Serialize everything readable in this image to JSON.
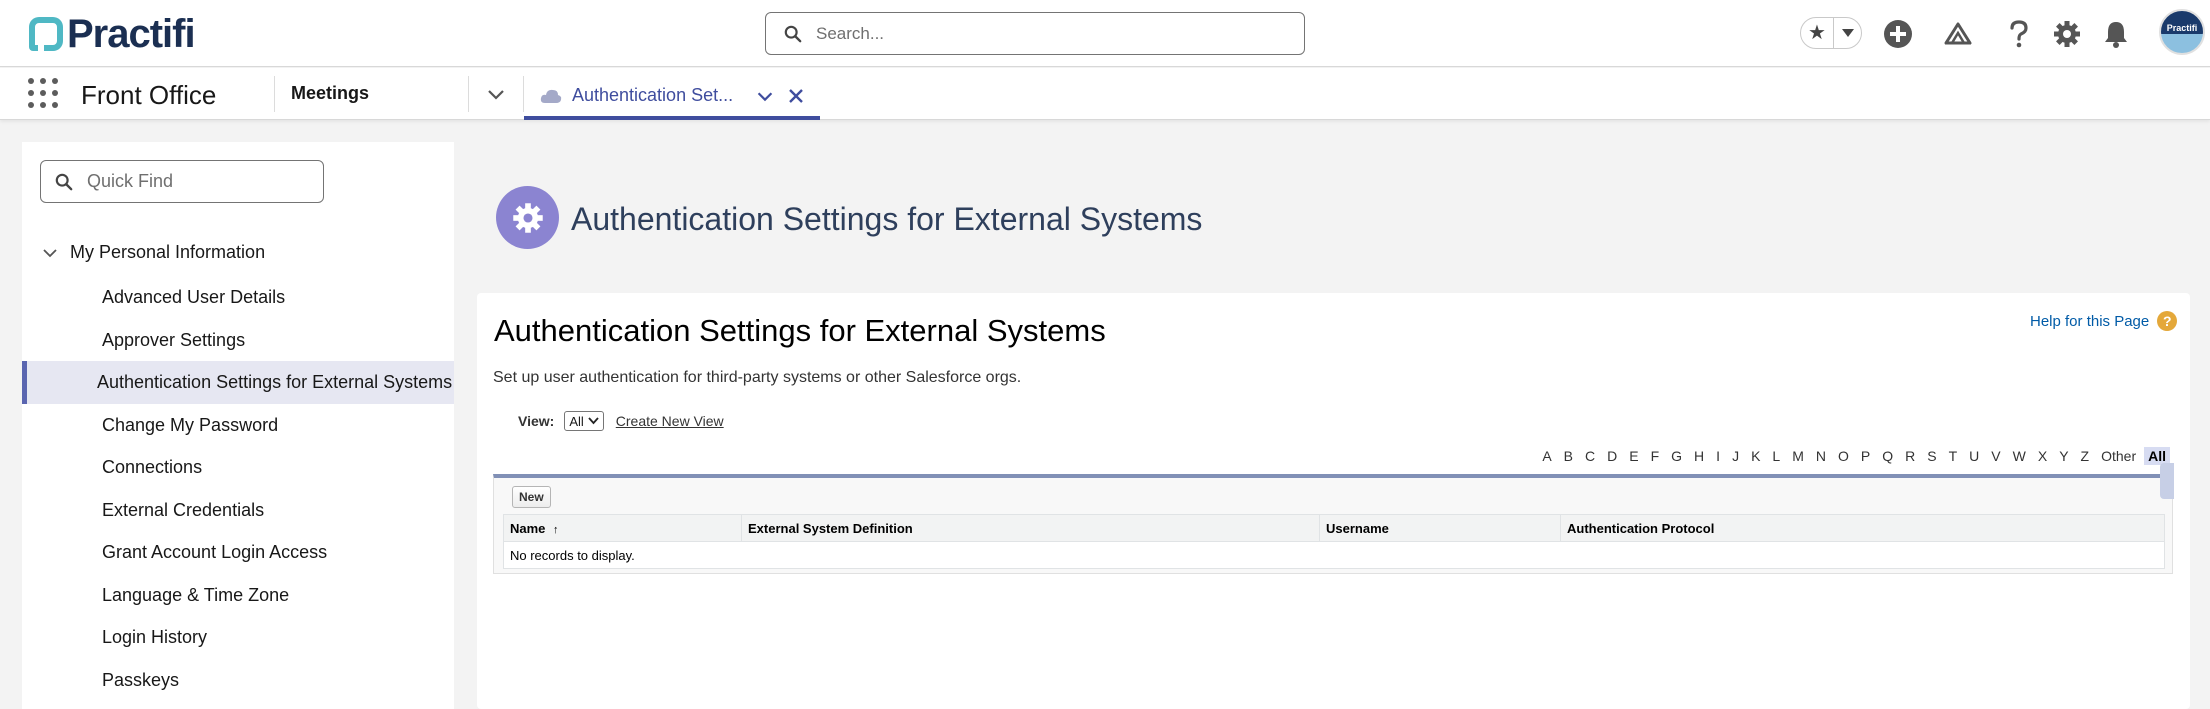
{
  "header": {
    "logo_text": "Practifi",
    "search_placeholder": "Search..."
  },
  "icons": {
    "favorites": "star-icon",
    "add": "plus-circle-icon",
    "trailhead": "mountain-icon",
    "help": "question-icon",
    "setup": "gear-icon",
    "notifications": "bell-icon"
  },
  "avatar": {
    "text": "Practifi"
  },
  "nav": {
    "app_name": "Front Office",
    "item": "Meetings",
    "active_tab": "Authentication Set..."
  },
  "sidebar": {
    "quick_find_placeholder": "Quick Find",
    "section": "My Personal Information",
    "items": [
      "Advanced User Details",
      "Approver Settings",
      "Authentication Settings for External Systems",
      "Change My Password",
      "Connections",
      "External Credentials",
      "Grant Account Login Access",
      "Language & Time Zone",
      "Login History",
      "Passkeys"
    ],
    "selected_index": 2
  },
  "page": {
    "heading": "Authentication Settings for External Systems",
    "card_title": "Authentication Settings for External Systems",
    "help_link": "Help for this Page",
    "description": "Set up user authentication for third-party systems or other Salesforce orgs.",
    "view_label": "View:",
    "view_value": "All",
    "create_view_link": "Create New View",
    "alphabet": [
      "A",
      "B",
      "C",
      "D",
      "E",
      "F",
      "G",
      "H",
      "I",
      "J",
      "K",
      "L",
      "M",
      "N",
      "O",
      "P",
      "Q",
      "R",
      "S",
      "T",
      "U",
      "V",
      "W",
      "X",
      "Y",
      "Z",
      "Other",
      "All"
    ],
    "new_button": "New",
    "columns": [
      "Name",
      "External System Definition",
      "Username",
      "Authentication Protocol"
    ],
    "sort_indicator": "↑",
    "empty_text": "No records to display."
  },
  "colors": {
    "accent": "#3f4d9e",
    "page_icon": "#8b84d1",
    "brand_teal": "#4fb8c4",
    "brand_navy": "#1b2f52"
  }
}
